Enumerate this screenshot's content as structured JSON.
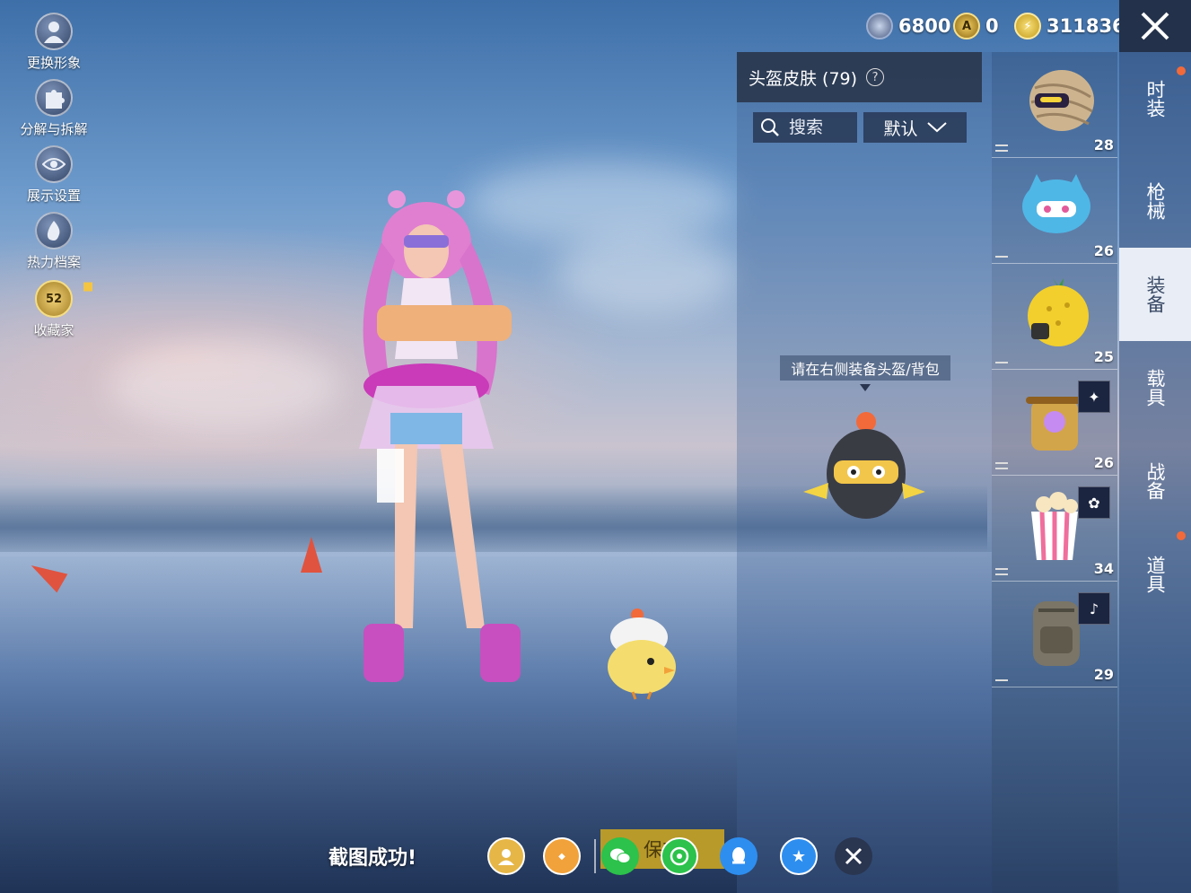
{
  "currencies": [
    {
      "icon": "silver-coin-icon",
      "value": "6800"
    },
    {
      "icon": "gold-coin-icon",
      "value": "0"
    },
    {
      "icon": "lightning-coin-icon",
      "value": "311836"
    }
  ],
  "left_menu": [
    {
      "label": "更换形象",
      "icon": "avatar-icon"
    },
    {
      "label": "分解与拆解",
      "icon": "puzzle-icon"
    },
    {
      "label": "展示设置",
      "icon": "eye-icon"
    },
    {
      "label": "热力档案",
      "icon": "flame-icon"
    },
    {
      "label": "收藏家",
      "icon": "collector-badge-icon",
      "badge": "52"
    }
  ],
  "panel": {
    "title": "头盔皮肤 (79)",
    "search_placeholder": "搜索",
    "sort_label": "默认",
    "hint": "请在右侧装备头盔/背包"
  },
  "items": [
    {
      "count": "28",
      "icon": "helmet-mummy-icon"
    },
    {
      "count": "26",
      "icon": "helmet-cat-icon"
    },
    {
      "count": "25",
      "icon": "helmet-pineapple-icon"
    },
    {
      "count": "26",
      "icon": "backpack-scroll-icon"
    },
    {
      "count": "34",
      "icon": "backpack-popcorn-icon"
    },
    {
      "count": "29",
      "icon": "backpack-tactical-icon"
    }
  ],
  "categories": [
    {
      "label": "时装"
    },
    {
      "label": "枪械"
    },
    {
      "label": "装备"
    },
    {
      "label": "载具"
    },
    {
      "label": "战备"
    },
    {
      "label": "道具"
    }
  ],
  "bottom": {
    "screenshot_text": "截图成功!",
    "save_label": "保存",
    "collector_badge": "52"
  },
  "colors": {
    "accent_orange": "#f26a3a",
    "save_gold": "#b89a2a",
    "panel_dark": "#23314a"
  }
}
